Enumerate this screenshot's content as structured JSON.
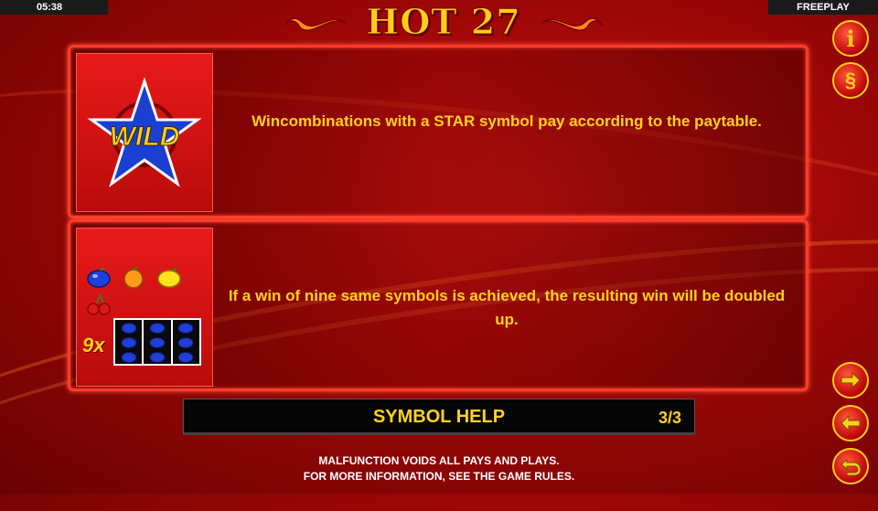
{
  "status": {
    "clock": "05:38",
    "mode": "FREEPLAY"
  },
  "logo": {
    "title": "HOT 27"
  },
  "panels": [
    {
      "symbol": "wild-star",
      "symbol_label": "WILD",
      "text": "Wincombinations with a STAR symbol pay according to the paytable."
    },
    {
      "symbols": [
        "plum",
        "orange",
        "lemon",
        "cherry"
      ],
      "multiplier_label": "9x",
      "grid_symbol": "plum",
      "text": "If a win of nine same symbols is achieved, the resulting win will be doubled up."
    }
  ],
  "help_bar": {
    "title": "SYMBOL HELP",
    "page": "3/3"
  },
  "footer": {
    "line1": "MALFUNCTION VOIDS ALL PAYS AND PLAYS.",
    "line2": "FOR MORE INFORMATION, SEE THE GAME RULES."
  },
  "side_buttons": {
    "info": "i",
    "rules": "§",
    "next": "next-arrow-icon",
    "prev": "prev-arrow-icon",
    "back": "return-icon"
  },
  "colors": {
    "accent_gold": "#ffd21e",
    "frame_red": "#ff3a2a",
    "bg_red": "#b90b0b"
  }
}
